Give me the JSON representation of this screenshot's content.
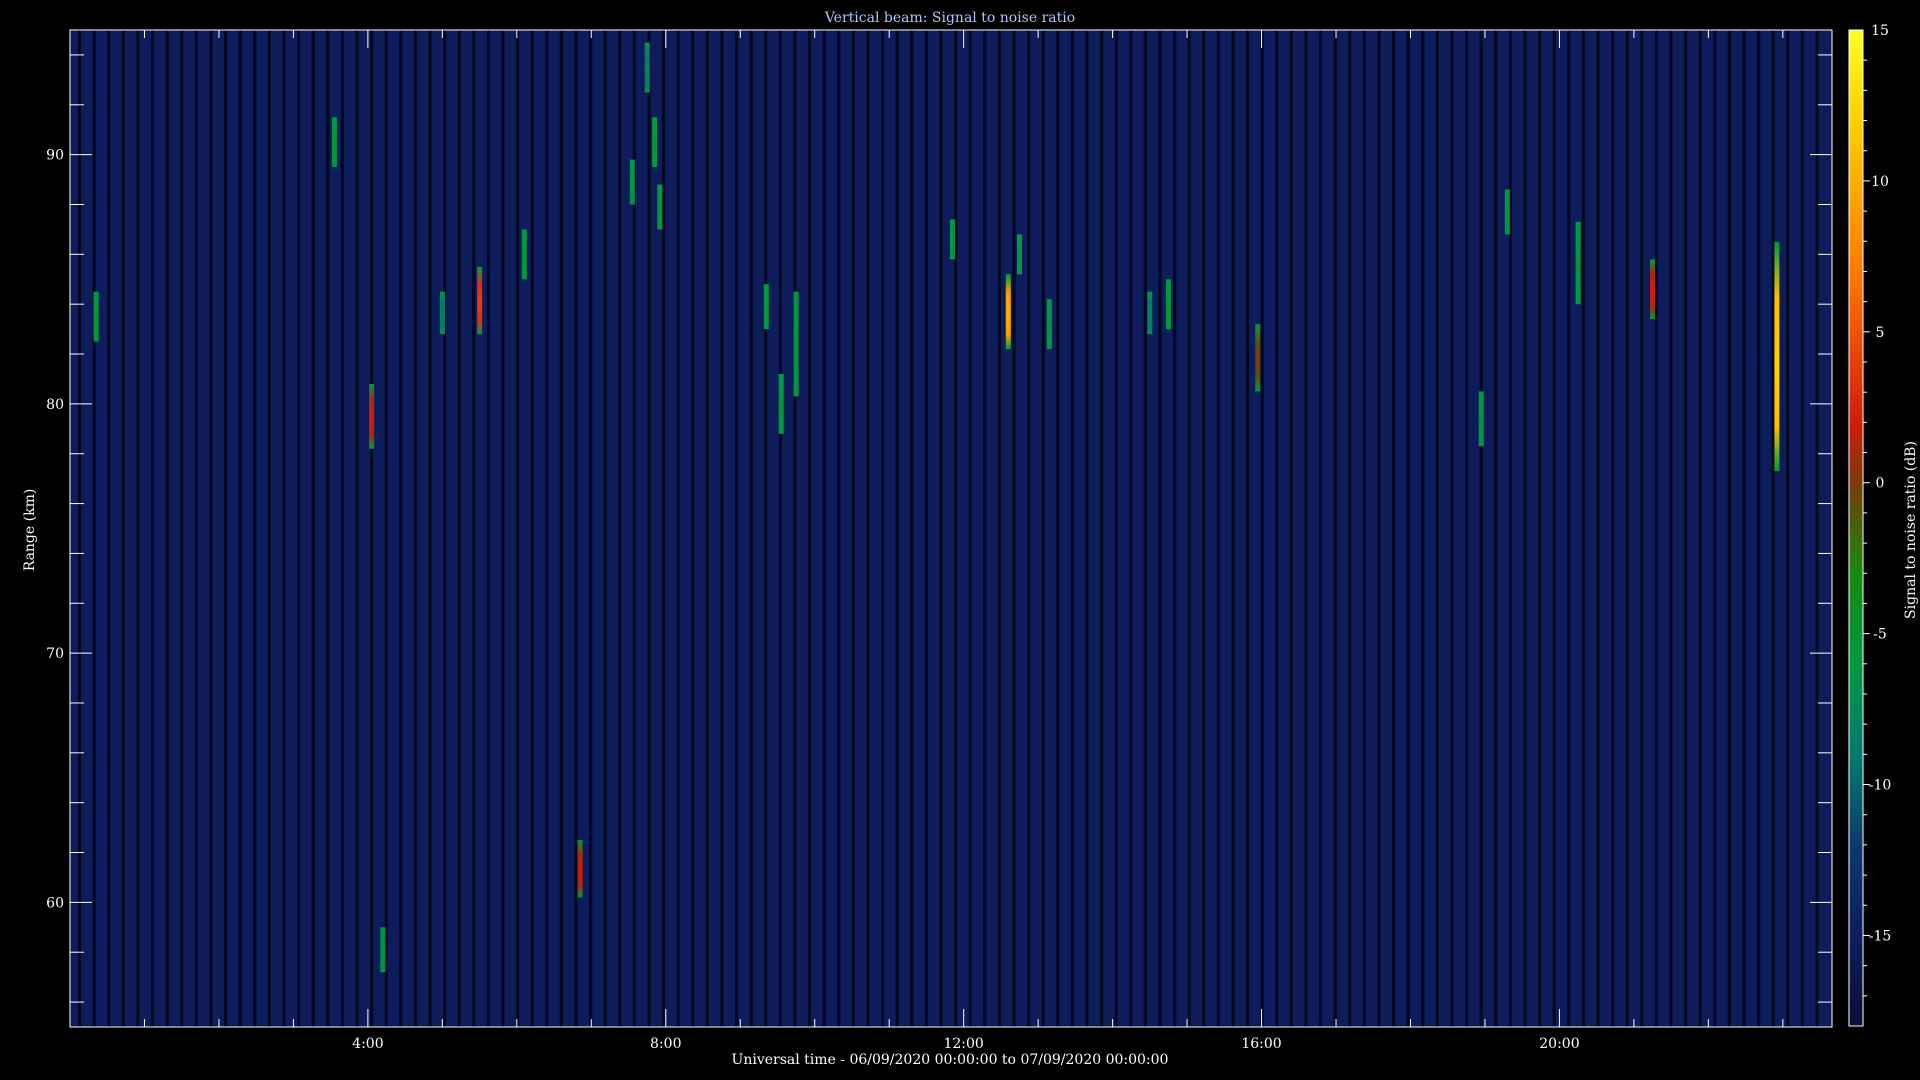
{
  "chart_data": {
    "type": "heatmap",
    "title": "Vertical beam: Signal to noise ratio",
    "xlabel": "Universal time - 06/09/2020 00:00:00 to 07/09/2020 00:00:00",
    "ylabel": "Range (km)",
    "xlim": [
      0,
      23.66
    ],
    "ylim": [
      55,
      95
    ],
    "x_ticks": [
      {
        "value": 4,
        "label": "4:00"
      },
      {
        "value": 8,
        "label": "8:00"
      },
      {
        "value": 12,
        "label": "12:00"
      },
      {
        "value": 16,
        "label": "16:00"
      },
      {
        "value": 20,
        "label": "20:00"
      }
    ],
    "y_ticks": [
      {
        "value": 60,
        "label": "60"
      },
      {
        "value": 70,
        "label": "70"
      },
      {
        "value": 80,
        "label": "80"
      },
      {
        "value": 90,
        "label": "90"
      }
    ],
    "colorbar": {
      "label": "Signal to noise ratio (dB)",
      "range": [
        -18,
        15
      ],
      "ticks": [
        {
          "value": 15,
          "label": "15"
        },
        {
          "value": 10,
          "label": "10"
        },
        {
          "value": 5,
          "label": "5"
        },
        {
          "value": 0,
          "label": "0"
        },
        {
          "value": -5,
          "label": "-5"
        },
        {
          "value": -10,
          "label": "-10"
        },
        {
          "value": -15,
          "label": "-15"
        }
      ],
      "stops": [
        {
          "value": -18,
          "color": "#0a0f3a"
        },
        {
          "value": -15,
          "color": "#0d1d5c"
        },
        {
          "value": -12,
          "color": "#0b3a6e"
        },
        {
          "value": -9,
          "color": "#007b6e"
        },
        {
          "value": -6,
          "color": "#009940"
        },
        {
          "value": -3,
          "color": "#168a10"
        },
        {
          "value": 0,
          "color": "#7a3a08"
        },
        {
          "value": 2,
          "color": "#d41a0a"
        },
        {
          "value": 7,
          "color": "#ff7a00"
        },
        {
          "value": 12,
          "color": "#ffd000"
        },
        {
          "value": 15,
          "color": "#ffff20"
        }
      ]
    },
    "background_snr": -15,
    "events": [
      {
        "t": 0.35,
        "r0": 82.5,
        "r1": 84.5,
        "snr": -5
      },
      {
        "t": 3.55,
        "r0": 89.5,
        "r1": 91.5,
        "snr": -5
      },
      {
        "t": 4.05,
        "r0": 78.2,
        "r1": 80.8,
        "snr": 2
      },
      {
        "t": 4.2,
        "r0": 57.2,
        "r1": 59.0,
        "snr": -6
      },
      {
        "t": 5.0,
        "r0": 82.8,
        "r1": 84.5,
        "snr": -8
      },
      {
        "t": 5.5,
        "r0": 82.8,
        "r1": 85.5,
        "snr": 4
      },
      {
        "t": 6.1,
        "r0": 85.0,
        "r1": 87.0,
        "snr": -5
      },
      {
        "t": 6.85,
        "r0": 60.2,
        "r1": 62.5,
        "snr": 2
      },
      {
        "t": 7.55,
        "r0": 88.0,
        "r1": 89.8,
        "snr": -6
      },
      {
        "t": 7.75,
        "r0": 92.5,
        "r1": 94.5,
        "snr": -8
      },
      {
        "t": 7.85,
        "r0": 89.5,
        "r1": 91.5,
        "snr": -5
      },
      {
        "t": 7.92,
        "r0": 87.0,
        "r1": 88.8,
        "snr": -5
      },
      {
        "t": 9.35,
        "r0": 83.0,
        "r1": 84.8,
        "snr": -5
      },
      {
        "t": 9.55,
        "r0": 78.8,
        "r1": 81.2,
        "snr": -5
      },
      {
        "t": 9.75,
        "r0": 80.3,
        "r1": 84.5,
        "snr": -5
      },
      {
        "t": 11.85,
        "r0": 85.8,
        "r1": 87.4,
        "snr": -6
      },
      {
        "t": 12.6,
        "r0": 82.2,
        "r1": 85.2,
        "snr": 10
      },
      {
        "t": 12.75,
        "r0": 85.2,
        "r1": 86.8,
        "snr": -5
      },
      {
        "t": 13.15,
        "r0": 82.2,
        "r1": 84.2,
        "snr": -5
      },
      {
        "t": 14.5,
        "r0": 82.8,
        "r1": 84.5,
        "snr": -8
      },
      {
        "t": 14.75,
        "r0": 83.0,
        "r1": 85.0,
        "snr": -5
      },
      {
        "t": 15.95,
        "r0": 80.5,
        "r1": 83.2,
        "snr": 0
      },
      {
        "t": 18.95,
        "r0": 78.3,
        "r1": 80.5,
        "snr": -5
      },
      {
        "t": 19.3,
        "r0": 86.8,
        "r1": 88.6,
        "snr": -5
      },
      {
        "t": 20.25,
        "r0": 84.0,
        "r1": 87.3,
        "snr": -5
      },
      {
        "t": 21.25,
        "r0": 83.4,
        "r1": 85.8,
        "snr": 2
      },
      {
        "t": 22.92,
        "r0": 77.3,
        "r1": 86.5,
        "snr": 12
      }
    ]
  }
}
